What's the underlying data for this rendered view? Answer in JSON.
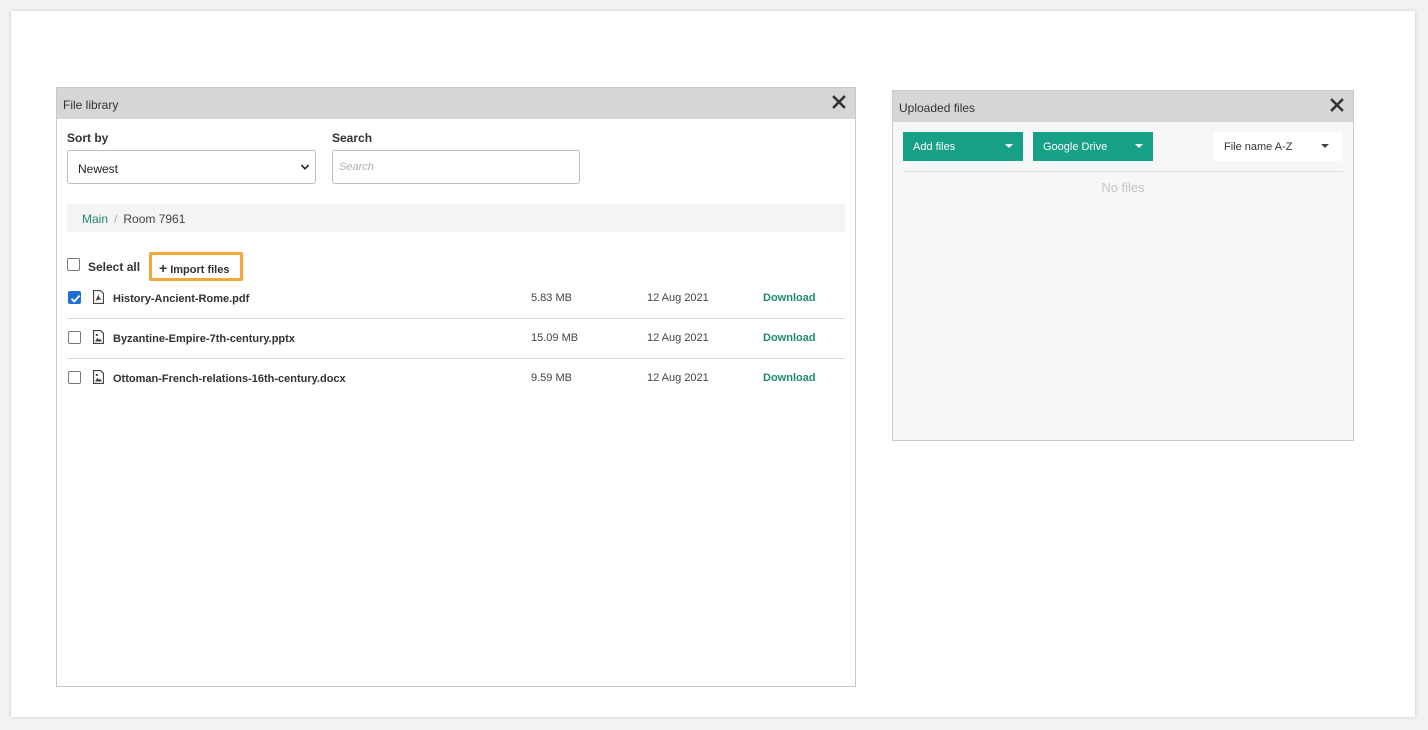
{
  "file_library": {
    "title": "File library",
    "sort_label": "Sort by",
    "sort_value": "Newest",
    "search_label": "Search",
    "search_placeholder": "Search",
    "breadcrumb": {
      "main": "Main",
      "separator": "/",
      "current": "Room 7961"
    },
    "select_all_label": "Select all",
    "import_label": "Import files",
    "files": [
      {
        "name": "History-Ancient-Rome.pdf",
        "size": "5.83 MB",
        "date": "12 Aug 2021",
        "action": "Download",
        "checked": true,
        "icon": "pdf-file-icon"
      },
      {
        "name": "Byzantine-Empire-7th-century.pptx",
        "size": "15.09 MB",
        "date": "12 Aug 2021",
        "action": "Download",
        "checked": false,
        "icon": "image-file-icon"
      },
      {
        "name": "Ottoman-French-relations-16th-century.docx",
        "size": "9.59 MB",
        "date": "12 Aug 2021",
        "action": "Download",
        "checked": false,
        "icon": "image-file-icon"
      }
    ]
  },
  "uploaded_files": {
    "title": "Uploaded files",
    "add_files_label": "Add files",
    "google_drive_label": "Google Drive",
    "sort_value": "File name A-Z",
    "empty_text": "No files"
  },
  "colors": {
    "accent": "#16a085",
    "link": "#1e8a6e",
    "highlight": "#f5a53a",
    "header_bg": "#d6d6d6",
    "checkbox_checked": "#1f6fd1"
  }
}
